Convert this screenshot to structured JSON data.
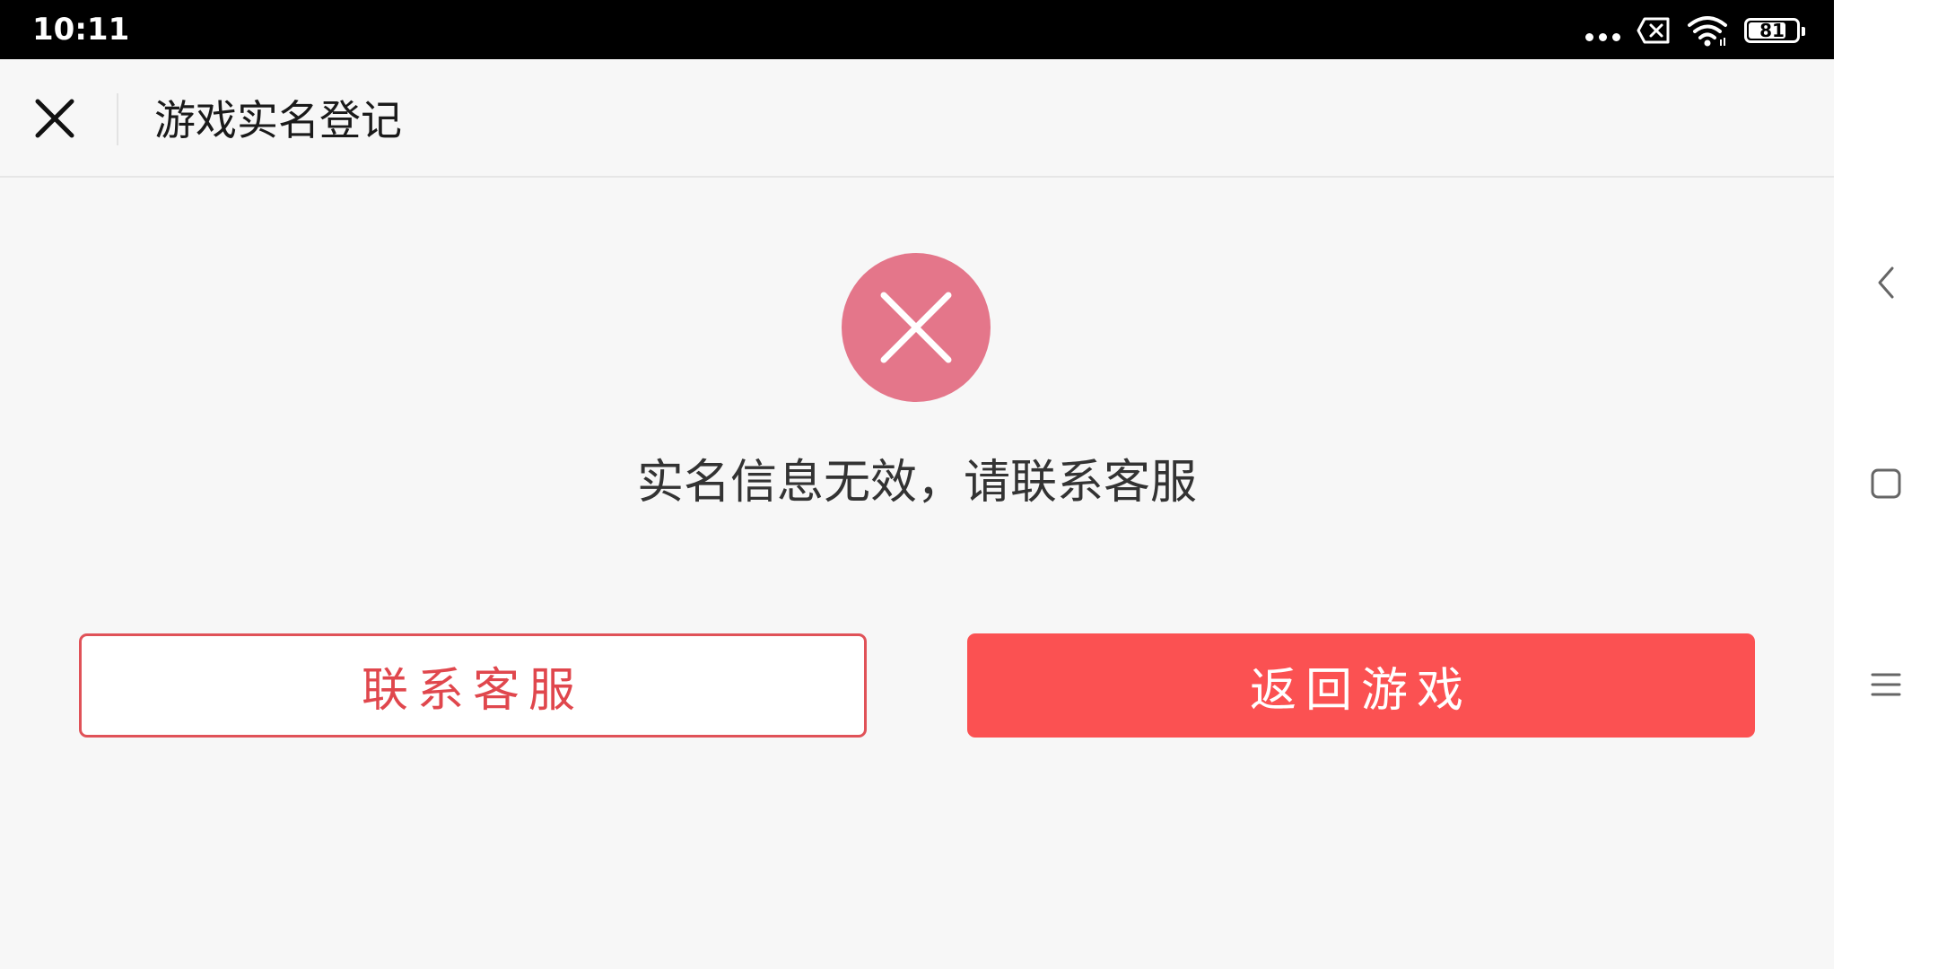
{
  "status_bar": {
    "time": "10:11",
    "battery_level": "81",
    "battery_fraction": 0.81,
    "icons": [
      "more-dots-icon",
      "sim-error-icon",
      "wifi-icon",
      "battery-icon"
    ]
  },
  "header": {
    "close_icon": "close-icon",
    "title": "游戏实名登记"
  },
  "result": {
    "icon": "error-x-icon",
    "icon_color": "#e4768a",
    "message": "实名信息无效，请联系客服"
  },
  "actions": {
    "contact_label": "联系客服",
    "contact_color": "#e0474d",
    "return_label": "返回游戏",
    "return_color": "#fb5152"
  },
  "nav_bar": {
    "icons": [
      "back-chevron-icon",
      "home-square-icon",
      "menu-lines-icon"
    ]
  }
}
